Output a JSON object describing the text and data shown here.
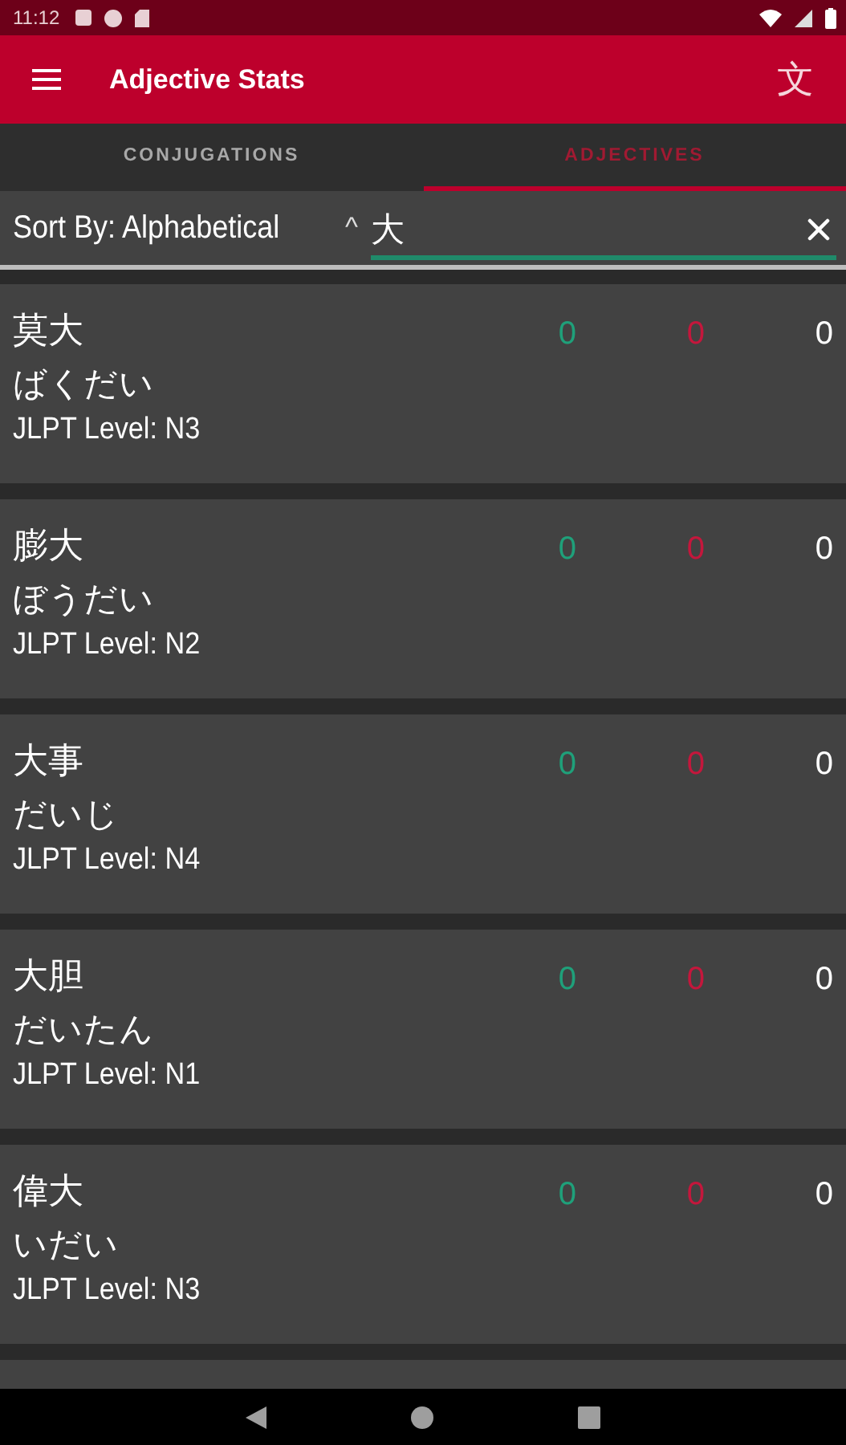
{
  "status_bar": {
    "time": "11:12"
  },
  "app_bar": {
    "title": "Adjective Stats",
    "action_glyph": "文"
  },
  "tabs": [
    {
      "label": "CONJUGATIONS",
      "selected": false
    },
    {
      "label": "ADJECTIVES",
      "selected": true
    }
  ],
  "sort_bar": {
    "label": "Sort By: Alphabetical",
    "caret": "^",
    "search_value": "大"
  },
  "adjectives": [
    {
      "kanji": "莫大",
      "reading": "ばくだい",
      "level": "JLPT Level: N3",
      "correct": "0",
      "wrong": "0",
      "total": "0"
    },
    {
      "kanji": "膨大",
      "reading": "ぼうだい",
      "level": "JLPT Level: N2",
      "correct": "0",
      "wrong": "0",
      "total": "0"
    },
    {
      "kanji": "大事",
      "reading": "だいじ",
      "level": "JLPT Level: N4",
      "correct": "0",
      "wrong": "0",
      "total": "0"
    },
    {
      "kanji": "大胆",
      "reading": "だいたん",
      "level": "JLPT Level: N1",
      "correct": "0",
      "wrong": "0",
      "total": "0"
    },
    {
      "kanji": "偉大",
      "reading": "いだい",
      "level": "JLPT Level: N3",
      "correct": "0",
      "wrong": "0",
      "total": "0"
    }
  ]
}
